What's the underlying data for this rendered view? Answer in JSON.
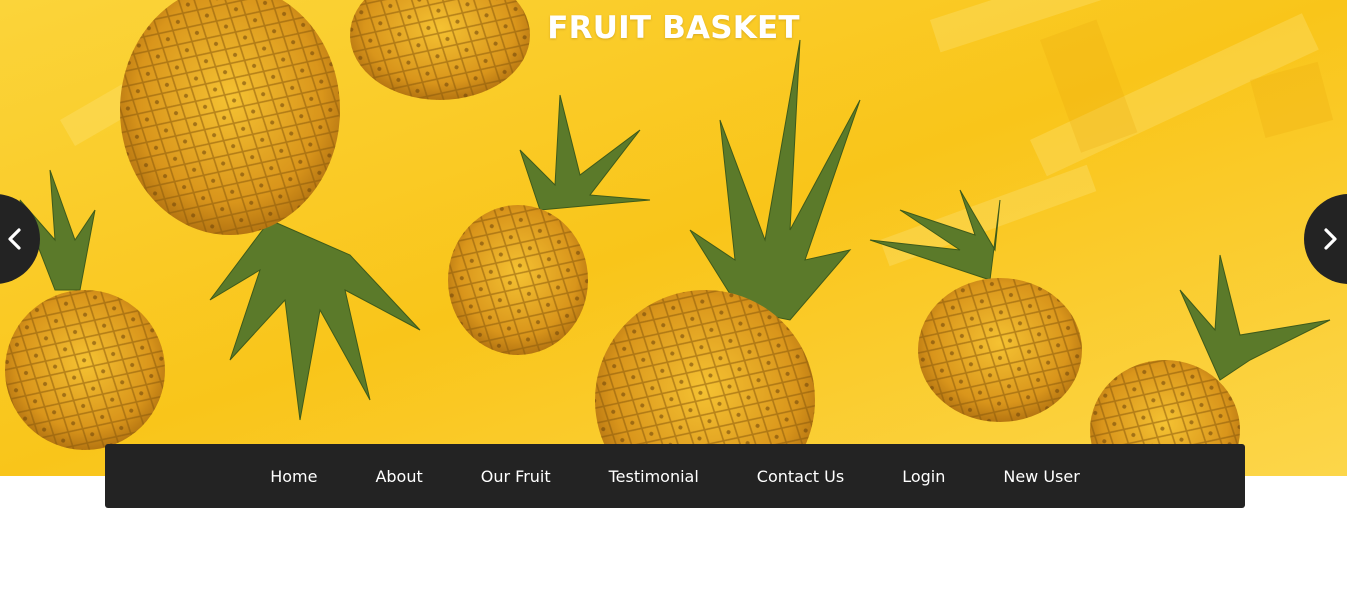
{
  "header": {
    "title": "FRUIT BASKET"
  },
  "slider": {
    "prev_icon": "chevron-left-icon",
    "next_icon": "chevron-right-icon",
    "background_image": "pineapples-on-yellow",
    "arrow_bg_color": "#232323"
  },
  "nav": {
    "items": [
      {
        "label": "Home"
      },
      {
        "label": "About"
      },
      {
        "label": "Our Fruit"
      },
      {
        "label": "Testimonial"
      },
      {
        "label": "Contact Us"
      },
      {
        "label": "Login"
      },
      {
        "label": "New User"
      }
    ],
    "bg_color": "#232323"
  },
  "colors": {
    "hero_yellow": "#f7c21b",
    "text_white": "#ffffff"
  }
}
